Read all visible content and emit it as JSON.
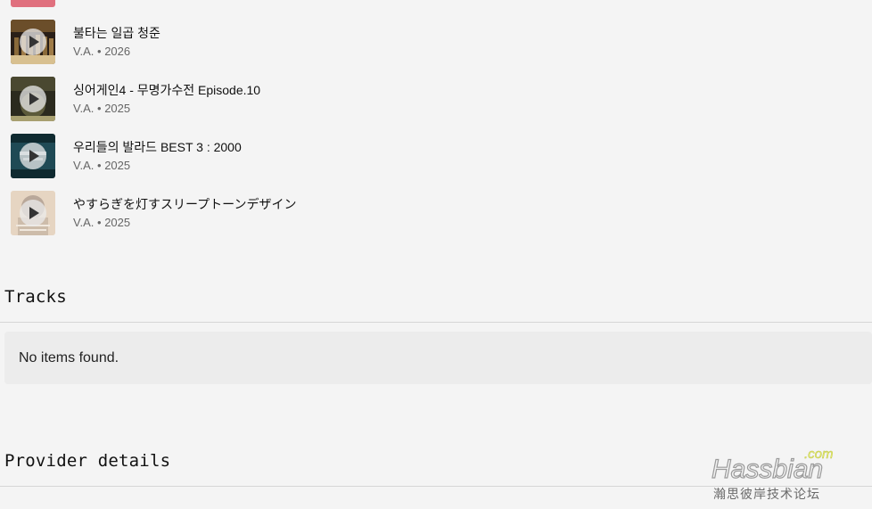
{
  "albums": [
    {
      "title": "불타는 일곱 청준",
      "artist": "V.A.",
      "year": "2026",
      "art_text": "불타는 일곱 청춘",
      "colors": [
        "#2a1f18",
        "#8a6a3a",
        "#d8c090"
      ]
    },
    {
      "title": "싱어게인4 - 무명가수전 Episode.10",
      "artist": "V.A.",
      "year": "2025",
      "art_text": "싱어게인4",
      "colors": [
        "#2b2a1e",
        "#5c5a3a",
        "#a8a070"
      ]
    },
    {
      "title": "우리들의 발라드 BEST 3 : 2000",
      "artist": "V.A.",
      "year": "2025",
      "art_text": "우리들의 발라드",
      "colors": [
        "#0f2a30",
        "#1f4a55",
        "#c8d8dc"
      ]
    },
    {
      "title": "やすらぎを灯すスリープトーンデザイン",
      "artist": "V.A.",
      "year": "2025",
      "art_text": "やすらぎを灯す",
      "colors": [
        "#b9a89a",
        "#e6d5c2",
        "#f0e8de"
      ]
    }
  ],
  "separator": "•",
  "sections": {
    "tracks_heading": "Tracks",
    "tracks_empty": "No items found.",
    "provider_heading": "Provider details"
  },
  "watermark": {
    "brand": "Hassbian",
    "suffix": ".com",
    "tagline": "瀚思彼岸技术论坛"
  }
}
